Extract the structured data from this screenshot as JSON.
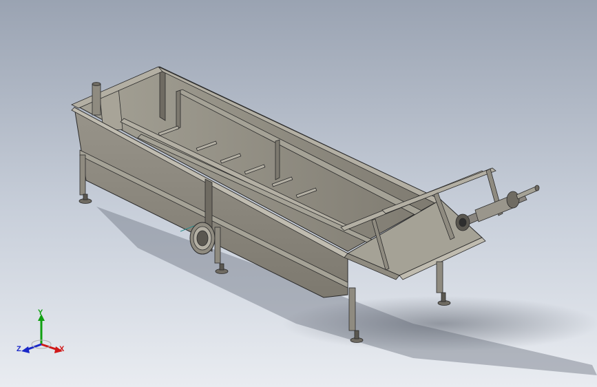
{
  "view": {
    "background_top": "#9aa3b2",
    "background_bottom": "#e9ecf1",
    "part_color": "#8f8b80",
    "part_shade": "#6f6b62",
    "part_light": "#b3afa3",
    "edge_color": "#2a2a2a"
  },
  "triad": {
    "x_label": "X",
    "y_label": "Y",
    "z_label": "Z",
    "x_color": "#d01818",
    "y_color": "#10a010",
    "z_color": "#1a28c8"
  }
}
